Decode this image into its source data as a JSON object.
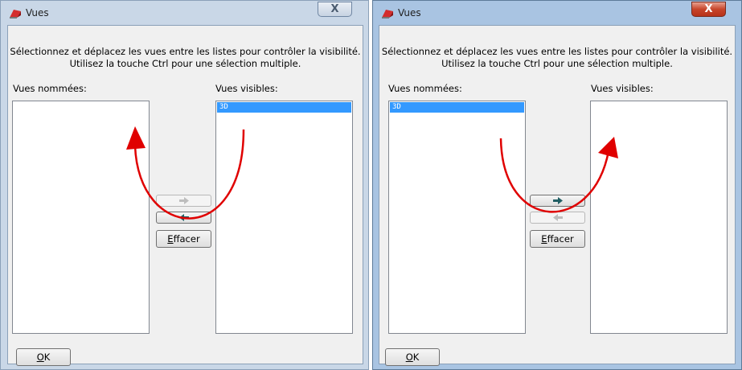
{
  "dialogs": [
    {
      "title": "Vues",
      "instructions_line1": "Sélectionnez et déplacez les vues entre les listes pour contrôler la visibilité.",
      "instructions_line2": "Utilisez la touche Ctrl pour une sélection multiple.",
      "left_label": "Vues nommées:",
      "right_label": "Vues visibles:",
      "left_items": [],
      "right_items": [
        "3D"
      ],
      "move_right_enabled": false,
      "move_left_enabled": true,
      "clear_mnemonic": "E",
      "clear_rest": "ffacer",
      "ok_mnemonic": "O",
      "ok_rest": "K",
      "close_glyph": "X",
      "close_active": false
    },
    {
      "title": "Vues",
      "instructions_line1": "Sélectionnez et déplacez les vues entre les listes pour contrôler la visibilité.",
      "instructions_line2": "Utilisez la touche Ctrl pour une sélection multiple.",
      "left_label": "Vues nommées:",
      "right_label": "Vues visibles:",
      "left_items": [
        "3D"
      ],
      "right_items": [],
      "move_right_enabled": true,
      "move_left_enabled": false,
      "clear_mnemonic": "E",
      "clear_rest": "ffacer",
      "ok_mnemonic": "O",
      "ok_rest": "K",
      "close_glyph": "X",
      "close_active": true
    }
  ],
  "icons": {
    "app": "app-icon",
    "move_right": "arrow-right-icon",
    "move_left": "arrow-left-icon",
    "annotation": "curved-arrow-annotation"
  },
  "colors": {
    "selection": "#3399ff",
    "annotation": "#e00000",
    "arrow_enabled": "#1f5e63",
    "arrow_disabled": "#bdbdbd"
  }
}
